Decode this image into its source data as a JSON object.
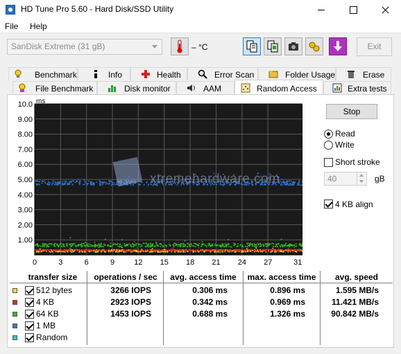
{
  "window": {
    "title": "HD Tune Pro 5.60 - Hard Disk/SSD Utility"
  },
  "menu": {
    "file": "File",
    "help": "Help"
  },
  "toolbar": {
    "drive": "SanDisk Extreme (31 gB)",
    "temperature": "– °C",
    "exit_label": "Exit"
  },
  "tabs_top": [
    "Benchmark",
    "Info",
    "Health",
    "Error Scan",
    "Folder Usage",
    "Erase"
  ],
  "tabs_bottom": [
    "File Benchmark",
    "Disk monitor",
    "AAM",
    "Random Access",
    "Extra tests"
  ],
  "active_tab": "Random Access",
  "controls": {
    "stop_label": "Stop",
    "read_label": "Read",
    "write_label": "Write",
    "mode_selected": "Read",
    "short_stroke_label": "Short stroke",
    "short_stroke_checked": false,
    "short_stroke_value": "40",
    "short_stroke_unit": "gB",
    "align_label": "4 KB align",
    "align_checked": true
  },
  "watermark": "xtremehardware.com",
  "chart_data": {
    "type": "scatter",
    "ylabel": "ms",
    "y_ticks": [
      "10.0",
      "9.00",
      "8.00",
      "7.00",
      "6.00",
      "5.00",
      "4.00",
      "3.00",
      "2.00",
      "1.00"
    ],
    "x_ticks": [
      "0",
      "3",
      "6",
      "9",
      "12",
      "15",
      "18",
      "21",
      "24",
      "27",
      "31gB"
    ],
    "xlim": [
      0,
      31
    ],
    "ylim": [
      0,
      10
    ],
    "grid": true,
    "background": "#1a1a1a",
    "series": [
      {
        "name": "512 bytes",
        "color": "#f0e030",
        "y_center": 0.306,
        "spread": 0.08
      },
      {
        "name": "4 KB",
        "color": "#e03020",
        "y_center": 0.342,
        "spread": 0.05
      },
      {
        "name": "64 KB",
        "color": "#30c020",
        "y_center": 0.688,
        "spread": 0.12
      },
      {
        "name": "1 MB",
        "color": "#2f78d8",
        "y_center": 4.8,
        "spread": 0.15
      }
    ]
  },
  "results": {
    "headers": [
      "transfer size",
      "operations / sec",
      "avg. access time",
      "max. access time",
      "avg. speed"
    ],
    "rows": [
      {
        "label": "512 bytes",
        "color": "#f0e030",
        "checked": true,
        "ops": "3266 IOPS",
        "avg": "0.306 ms",
        "max": "0.896 ms",
        "speed": "1.595 MB/s"
      },
      {
        "label": "4 KB",
        "color": "#d03020",
        "checked": true,
        "ops": "2923 IOPS",
        "avg": "0.342 ms",
        "max": "0.969 ms",
        "speed": "11.421 MB/s"
      },
      {
        "label": "64 KB",
        "color": "#30c020",
        "checked": true,
        "ops": "1453 IOPS",
        "avg": "0.688 ms",
        "max": "1.326 ms",
        "speed": "90.842 MB/s"
      },
      {
        "label": "1 MB",
        "color": "#2f78d8",
        "checked": true,
        "ops": "",
        "avg": "",
        "max": "",
        "speed": ""
      },
      {
        "label": "Random",
        "color": "#30c8c8",
        "checked": true,
        "ops": "",
        "avg": "",
        "max": "",
        "speed": ""
      }
    ]
  }
}
